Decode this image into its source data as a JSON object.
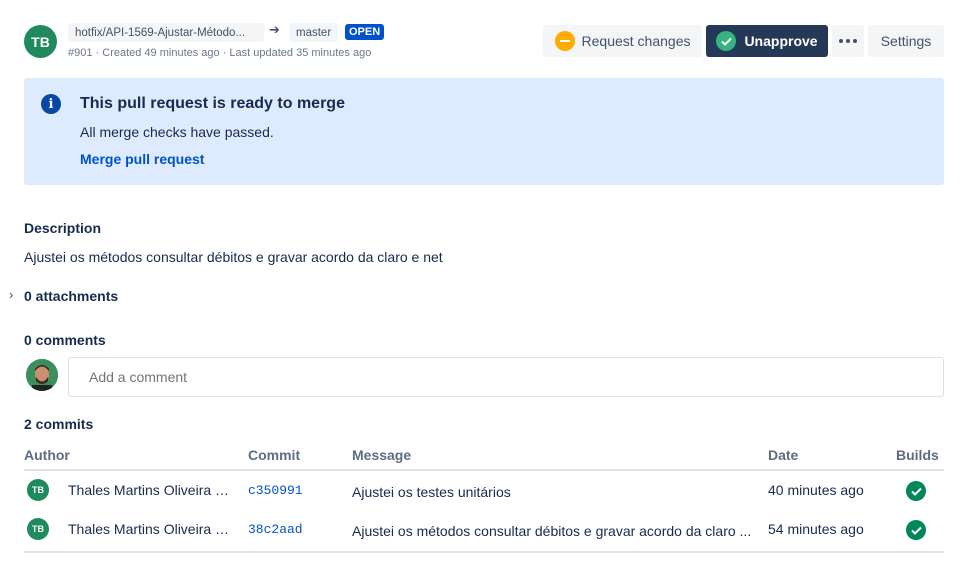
{
  "header": {
    "avatar_initials": "TB",
    "source_branch": "hotfix/API-1569-Ajustar-Método...",
    "target_branch": "master",
    "status": "OPEN",
    "meta": "#901 · Created 49 minutes ago · Last updated 35 minutes ago"
  },
  "actions": {
    "request_changes": "Request changes",
    "unapprove": "Unapprove",
    "settings": "Settings"
  },
  "merge_panel": {
    "title": "This pull request is ready to merge",
    "text": "All merge checks have passed.",
    "link": "Merge pull request"
  },
  "description": {
    "heading": "Description",
    "text": "Ajustei os métodos consultar débitos e gravar acordo da claro e net"
  },
  "attachments": {
    "label": "0 attachments"
  },
  "comments": {
    "heading": "0 comments",
    "placeholder": "Add a comment"
  },
  "commits": {
    "heading": "2 commits",
    "columns": {
      "author": "Author",
      "commit": "Commit",
      "message": "Message",
      "date": "Date",
      "builds": "Builds"
    },
    "rows": [
      {
        "avatar": "TB",
        "author": "Thales Martins Oliveira B...",
        "hash": "c350991",
        "message": "Ajustei os testes unitários",
        "date": "40 minutes ago",
        "build_status": "success"
      },
      {
        "avatar": "TB",
        "author": "Thales Martins Oliveira B...",
        "hash": "38c2aad",
        "message": "Ajustei os métodos consultar débitos e gravar acordo da claro ...",
        "date": "54 minutes ago",
        "build_status": "success"
      }
    ]
  },
  "colors": {
    "accent": "#0052cc",
    "panel_bg": "#deebff",
    "primary_button": "#253858",
    "success": "#00875a",
    "warning": "#ffab00"
  }
}
